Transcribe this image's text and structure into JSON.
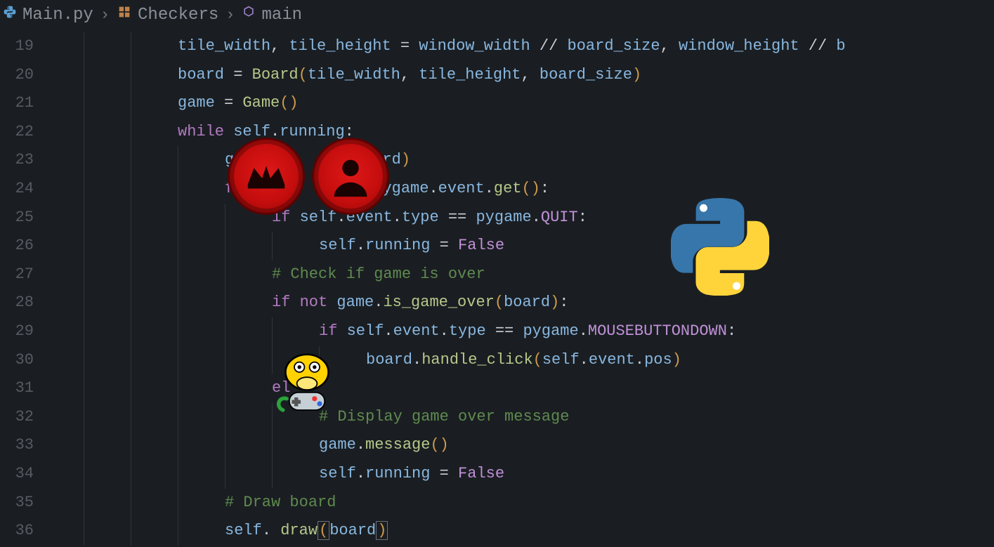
{
  "breadcrumb": {
    "file": "Main.py",
    "class": "Checkers",
    "func": "main"
  },
  "lines": {
    "19": "        tile_width, tile_height = window_width // board_size, window_height // b",
    "20": "        board = Board(tile_width, tile_height, board_size)",
    "21": "        game = Game()",
    "22": "        while self.running:",
    "23": "            game.tick(board)",
    "24": "            for self.event in pygame.event.get():",
    "25": "                if self.event.type == pygame.QUIT:",
    "26": "                    self.running = False",
    "27": "                # Check if game is over",
    "28": "                if not game.is_game_over(board):",
    "29": "                    if self.event.type == pygame.MOUSEBUTTONDOWN:",
    "30": "                        board.handle_click(self.event.pos)",
    "31": "                else:",
    "32": "                    # Display game over message",
    "33": "                    game.message()",
    "34": "                    self.running = False",
    "35": "            # Draw board",
    "36": "            self. draw(board)"
  },
  "overlays": {
    "checker_king": "crown-icon",
    "checker_man": "person-icon",
    "python_logo": "python-icon",
    "pygame_logo": "pygame-snake-icon"
  }
}
